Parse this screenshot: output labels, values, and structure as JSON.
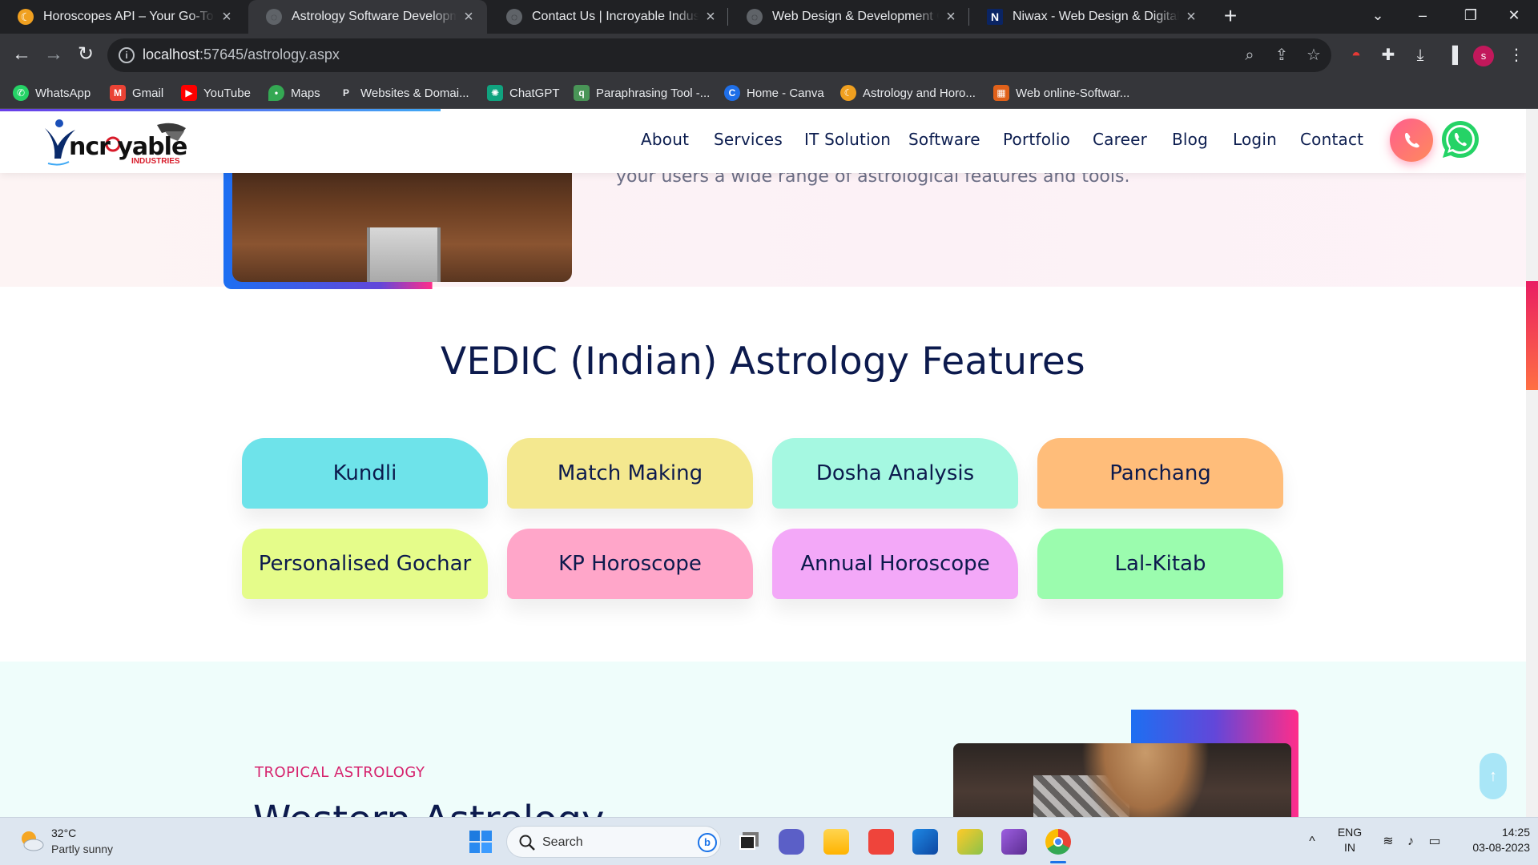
{
  "browser": {
    "tabs": [
      {
        "label": "Horoscopes API – Your Go-To Solution",
        "active": false,
        "favicon_color": "#f0a020",
        "favicon": "astrology-icon"
      },
      {
        "label": "Astrology Software Development",
        "active": true,
        "favicon_color": "#5f6368",
        "favicon": "globe-icon"
      },
      {
        "label": "Contact Us | Incroyable Industries",
        "active": false,
        "favicon_color": "#5f6368",
        "favicon": "globe-icon"
      },
      {
        "label": "Web Design & Development Company",
        "active": false,
        "favicon_color": "#5f6368",
        "favicon": "globe-icon"
      },
      {
        "label": "Niwax - Web Design & Digital Marketing",
        "active": false,
        "favicon_color": "#0a2463",
        "favicon": "niwax-icon"
      }
    ],
    "url_host": "localhost",
    "url_path": ":57645/astrology.aspx",
    "bookmarks": [
      {
        "label": "WhatsApp",
        "icon": "whatsapp-icon",
        "color": "#25d366"
      },
      {
        "label": "Gmail",
        "icon": "gmail-icon",
        "color": "#ea4335"
      },
      {
        "label": "YouTube",
        "icon": "youtube-icon",
        "color": "#ff0000"
      },
      {
        "label": "Maps",
        "icon": "maps-icon",
        "color": "#34a853"
      },
      {
        "label": "Websites & Domai...",
        "icon": "p-icon",
        "color": "#35363a"
      },
      {
        "label": "ChatGPT",
        "icon": "chatgpt-icon",
        "color": "#10a37f"
      },
      {
        "label": "Paraphrasing Tool -...",
        "icon": "quillbot-icon",
        "color": "#499557"
      },
      {
        "label": "Home - Canva",
        "icon": "canva-icon",
        "color": "#1f6fe8"
      },
      {
        "label": "Astrology and Horo...",
        "icon": "astrology-icon",
        "color": "#f0a020"
      },
      {
        "label": "Web online-Softwar...",
        "icon": "grid-icon",
        "color": "#e0611a"
      }
    ],
    "profile_initial": "s"
  },
  "site": {
    "logo_text": "ncr yable",
    "logo_sub": "INDUSTRIES",
    "nav": [
      "About",
      "Services",
      "IT Solution",
      "Software",
      "Portfolio",
      "Career",
      "Blog",
      "Login",
      "Contact"
    ],
    "hero_text": "your users a wide range of astrological features and tools.",
    "features_title": "VEDIC (Indian) Astrology Features",
    "features": [
      {
        "label": "Kundli",
        "color": "#6ee3ea"
      },
      {
        "label": "Match Making",
        "color": "#f4e88f"
      },
      {
        "label": "Dosha Analysis",
        "color": "#a5f8e1"
      },
      {
        "label": "Panchang",
        "color": "#ffbd7a"
      },
      {
        "label": "Personalised Gochar",
        "color": "#e5fc8a"
      },
      {
        "label": "KP Horoscope",
        "color": "#ffa6c9"
      },
      {
        "label": "Annual Horoscope",
        "color": "#f3a8f8"
      },
      {
        "label": "Lal-Kitab",
        "color": "#9bfcae"
      }
    ],
    "tropical_label": "TROPICAL ASTROLOGY",
    "western_title": "Western Astrology"
  },
  "taskbar": {
    "temp": "32°C",
    "weather": "Partly sunny",
    "search_placeholder": "Search",
    "lang_top": "ENG",
    "lang_bottom": "IN",
    "time": "14:25",
    "date": "03-08-2023"
  }
}
